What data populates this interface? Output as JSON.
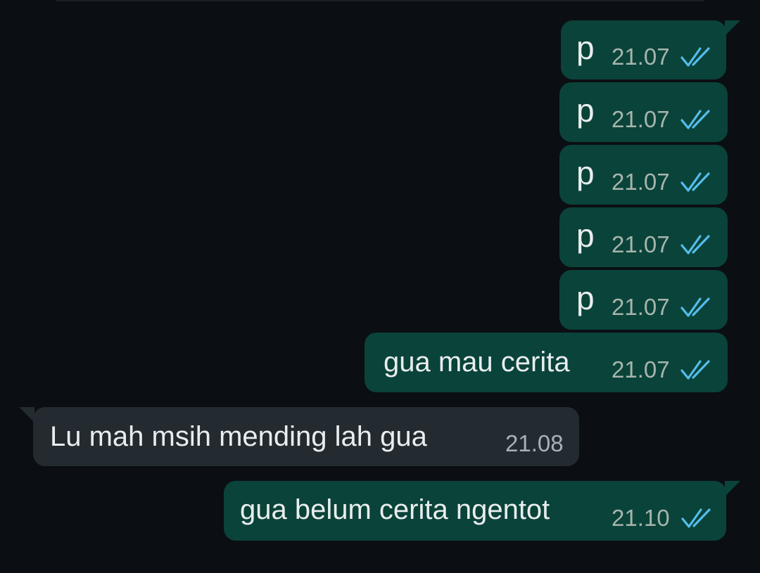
{
  "chat": {
    "messages": [
      {
        "direction": "out",
        "text": "p",
        "time": "21.07",
        "status": "read-ticks-icon"
      },
      {
        "direction": "out",
        "text": "p",
        "time": "21.07",
        "status": "read-ticks-icon"
      },
      {
        "direction": "out",
        "text": "p",
        "time": "21.07",
        "status": "read-ticks-icon"
      },
      {
        "direction": "out",
        "text": "p",
        "time": "21.07",
        "status": "read-ticks-icon"
      },
      {
        "direction": "out",
        "text": "p",
        "time": "21.07",
        "status": "read-ticks-icon"
      },
      {
        "direction": "out",
        "text": "gua mau cerita",
        "time": "21.07",
        "status": "read-ticks-icon"
      },
      {
        "direction": "in",
        "text": "Lu mah msih mending lah gua",
        "time": "21.08"
      },
      {
        "direction": "out",
        "text": "gua belum cerita ngentot",
        "time": "21.10",
        "status": "read-ticks-icon"
      }
    ]
  },
  "colors": {
    "background": "#0b0e13",
    "outgoing_bubble": "#0a4339",
    "incoming_bubble": "#232b30",
    "read_tick": "#53bdeb"
  }
}
